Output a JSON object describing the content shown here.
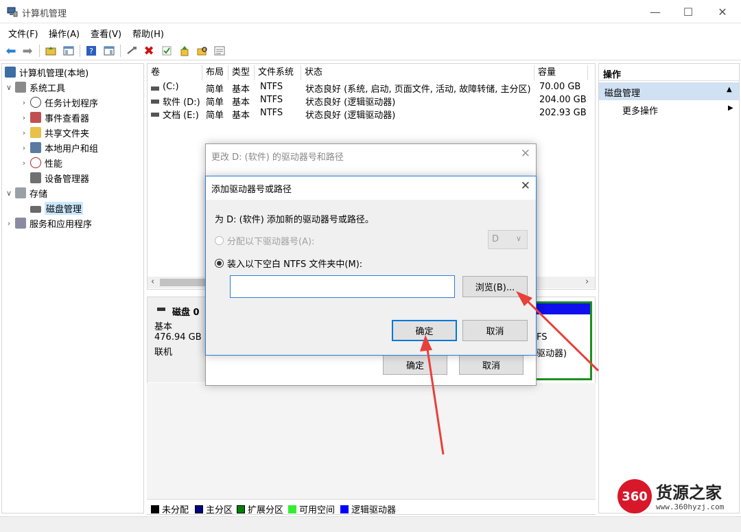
{
  "window": {
    "title": "计算机管理",
    "controls": {
      "minimize": "—",
      "maximize": "☐",
      "close": "✕"
    }
  },
  "menu": [
    "文件(F)",
    "操作(A)",
    "查看(V)",
    "帮助(H)"
  ],
  "tree": {
    "root": "计算机管理(本地)",
    "items": [
      {
        "label": "系统工具",
        "level": 1,
        "expanded": true
      },
      {
        "label": "任务计划程序",
        "level": 2
      },
      {
        "label": "事件查看器",
        "level": 2
      },
      {
        "label": "共享文件夹",
        "level": 2
      },
      {
        "label": "本地用户和组",
        "level": 2
      },
      {
        "label": "性能",
        "level": 2
      },
      {
        "label": "设备管理器",
        "level": 2
      },
      {
        "label": "存储",
        "level": 1,
        "expanded": true
      },
      {
        "label": "磁盘管理",
        "level": 2,
        "selected": true
      },
      {
        "label": "服务和应用程序",
        "level": 1
      }
    ]
  },
  "volumes": {
    "columns": [
      "卷",
      "布局",
      "类型",
      "文件系统",
      "状态",
      "容量"
    ],
    "rows": [
      {
        "vol": "(C:)",
        "layout": "简单",
        "type": "基本",
        "fs": "NTFS",
        "status": "状态良好 (系统, 启动, 页面文件, 活动, 故障转储, 主分区)",
        "capacity": "70.00 GB"
      },
      {
        "vol": "软件 (D:)",
        "layout": "简单",
        "type": "基本",
        "fs": "NTFS",
        "status": "状态良好 (逻辑驱动器)",
        "capacity": "204.00 GB"
      },
      {
        "vol": "文档 (E:)",
        "layout": "简单",
        "type": "基本",
        "fs": "NTFS",
        "status": "状态良好 (逻辑驱动器)",
        "capacity": "202.93 GB"
      }
    ]
  },
  "disk": {
    "name": "磁盘 0",
    "type": "基本",
    "size": "476.94 GB",
    "state": "联机",
    "partial_fs": "FS",
    "partial_status": "驱动器)"
  },
  "legend": [
    {
      "label": "未分配",
      "color": "#000000"
    },
    {
      "label": "主分区",
      "color": "#000080"
    },
    {
      "label": "扩展分区",
      "color": "#008000"
    },
    {
      "label": "可用空间",
      "color": "#33ee33"
    },
    {
      "label": "逻辑驱动器",
      "color": "#0000ff"
    }
  ],
  "actions": {
    "header": "操作",
    "section": "磁盘管理",
    "more": "更多操作"
  },
  "dialog_back": {
    "title": "更改 D: (软件) 的驱动器号和路径",
    "ok": "确定",
    "cancel": "取消"
  },
  "dialog_front": {
    "title": "添加驱动器号或路径",
    "instruction": "为 D: (软件) 添加新的驱动器号或路径。",
    "option_letter": "分配以下驱动器号(A):",
    "letter_value": "D",
    "option_folder": "装入以下空白 NTFS 文件夹中(M):",
    "folder_value": "",
    "browse": "浏览(B)...",
    "ok": "确定",
    "cancel": "取消"
  },
  "watermark": {
    "logo": "360",
    "text": "货源之家",
    "url": "www.360hyzj.com"
  },
  "colors": {
    "annotation_arrow": "#e8403a",
    "selection": "#cce8ff",
    "accent": "#0078d7"
  }
}
